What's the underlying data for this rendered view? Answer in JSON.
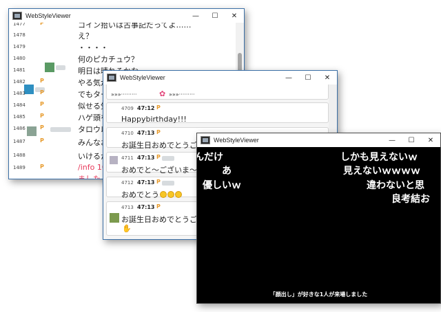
{
  "window1": {
    "title": "WebStyleViewer",
    "rows": [
      {
        "num": "1477",
        "premium": "P",
        "text": "コイン拾いは古事記だってよ……",
        "red": false
      },
      {
        "num": "1478",
        "premium": "",
        "text": "え？",
        "red": false
      },
      {
        "num": "1479",
        "premium": "",
        "text": "・・・・",
        "red": false
      },
      {
        "num": "1480",
        "premium": "",
        "text": "何のピカチュウ？",
        "red": false
      },
      {
        "num": "1481",
        "premium": "",
        "text": "明日は晴れるかな",
        "red": false
      },
      {
        "num": "1482",
        "premium": "P",
        "text": "やる気が",
        "red": false
      },
      {
        "num": "1483",
        "premium": "P",
        "text": "でもター",
        "red": false
      },
      {
        "num": "1484",
        "premium": "P",
        "text": "似せる気",
        "red": false
      },
      {
        "num": "1485",
        "premium": "P",
        "text": "ハゲ頭を",
        "red": false
      },
      {
        "num": "1486",
        "premium": "P",
        "text": "タロウ以",
        "red": false
      },
      {
        "num": "1487",
        "premium": "P",
        "text": "みんなお",
        "red": false
      },
      {
        "num": "1488",
        "premium": "",
        "text": "いけるか",
        "red": false
      },
      {
        "num": "1489",
        "premium": "P",
        "text": "/info 10",
        "red": true
      },
      {
        "num": "",
        "premium": "",
        "text": "ました",
        "red": true
      }
    ]
  },
  "window2": {
    "title": "WebStyleViewer",
    "stamp_text": "»»»·········",
    "cards": [
      {
        "id": "4709",
        "time": "47:12",
        "premium": "P",
        "text": "Happybirthday!!!",
        "smileys": 0
      },
      {
        "id": "4710",
        "time": "47:13",
        "premium": "P",
        "text": "お誕生日おめでとうござ",
        "smileys": 0
      },
      {
        "id": "4711",
        "time": "47:13",
        "premium": "P",
        "text": "おめでと～ございま～す",
        "smileys": 0
      },
      {
        "id": "4712",
        "time": "47:13",
        "premium": "P",
        "text": "おめでとう",
        "smileys": 3
      },
      {
        "id": "4713",
        "time": "47:13",
        "premium": "P",
        "text": "お誕生日おめでとうござ",
        "smileys": 0
      }
    ]
  },
  "window3": {
    "title": "WebStyleViewer",
    "flow_comments": [
      {
        "text": "んだけ"
      },
      {
        "text": "しかも見えないｗ"
      },
      {
        "text": "あ"
      },
      {
        "text": "見えないｗｗｗｗ"
      },
      {
        "text": "優しいｗ"
      },
      {
        "text": "違わないと思"
      },
      {
        "text": "良考結お"
      }
    ],
    "system_message": "「顔出し」が好きな1人が来場しました"
  },
  "colors": {
    "window_border": "#3a6ea5",
    "premium_mark": "#e79a2b",
    "info_red": "#e8385a",
    "flow_background": "#000000"
  },
  "icons": {
    "minimize": "minimize-icon",
    "maximize": "maximize-icon",
    "close": "close-icon"
  }
}
